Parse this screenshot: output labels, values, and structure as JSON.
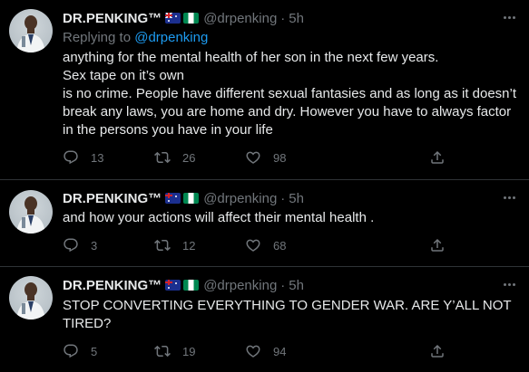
{
  "author": {
    "name": "DR.PENKING™",
    "handle": "@drpenking",
    "flags": [
      "australia-flag",
      "nigeria-flag"
    ]
  },
  "colors": {
    "background": "#000000",
    "text": "#e7e9ea",
    "muted": "#71767b",
    "link": "#1d9bf0",
    "divider": "#2f3336"
  },
  "tweets": [
    {
      "time": "5h",
      "replying_prefix": "Replying to ",
      "replying_handle": "@drpenking",
      "lines": [
        "anything for the mental health of her son in the next few years.",
        "Sex tape on it’s own",
        "is no crime. People have different sexual fantasies and as long as it doesn’t break any laws, you are home and dry. However you have to always factor in the persons you have in your life"
      ],
      "replies": "13",
      "retweets": "26",
      "likes": "98"
    },
    {
      "time": "5h",
      "lines": [
        "and how your actions will affect their mental health ."
      ],
      "replies": "3",
      "retweets": "12",
      "likes": "68"
    },
    {
      "time": "5h",
      "lines": [
        "STOP CONVERTING EVERYTHING TO GENDER WAR. ARE Y’ALL NOT TIRED?"
      ],
      "replies": "5",
      "retweets": "19",
      "likes": "94"
    }
  ]
}
